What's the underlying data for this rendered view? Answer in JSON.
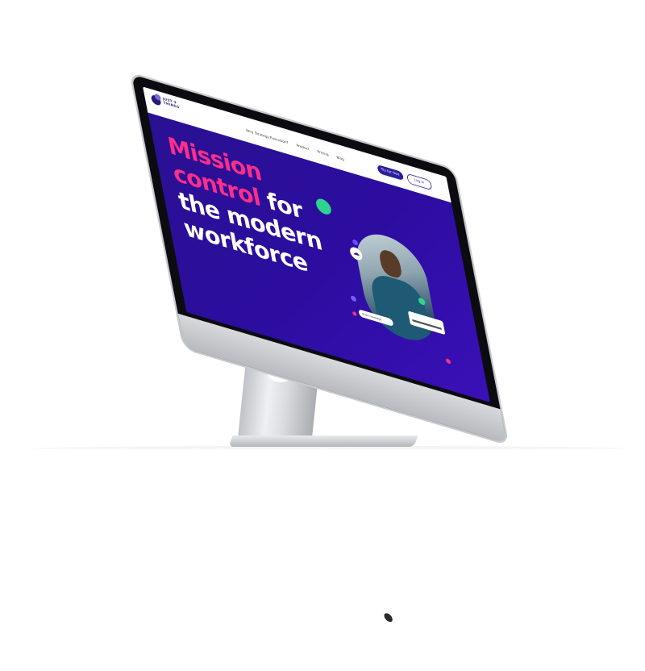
{
  "device": {
    "brand_icon": "apple-logo-icon"
  },
  "site": {
    "logo": {
      "line1": "JUST 3",
      "line2": "THINGS"
    },
    "nav": {
      "links": [
        "Why Strategy Execution?",
        "Product",
        "Pricing",
        "Blog"
      ],
      "try_button": "Try for free",
      "login_button": "Log in"
    },
    "hero": {
      "line1": "Mission",
      "line2_pink": "control",
      "line2_white": " for",
      "line3": "the modern",
      "line4": "workforce"
    },
    "widgets": {
      "message_label": "Start message",
      "cloud_icon": "cloud-icon"
    },
    "colors": {
      "accent_pink": "#ff2d8b",
      "background_purple": "#2c0da0",
      "accent_green": "#2ed38f",
      "brand_navy": "#2a1a7a"
    }
  }
}
